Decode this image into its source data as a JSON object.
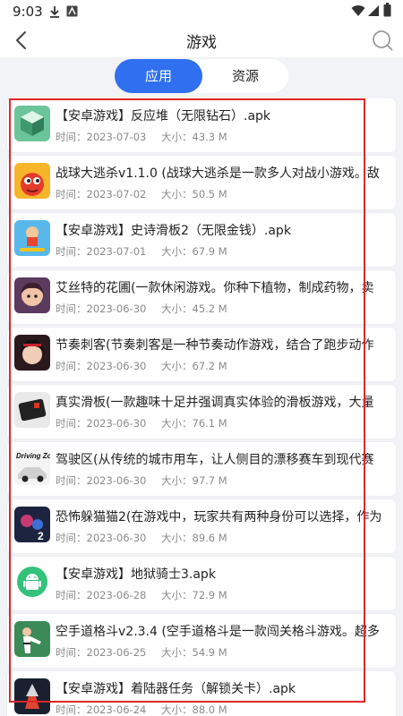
{
  "status": {
    "time": "9:03"
  },
  "header": {
    "title": "游戏"
  },
  "tabs": [
    {
      "label": "应用",
      "active": true
    },
    {
      "label": "资源",
      "active": false
    }
  ],
  "items": [
    {
      "name": "【安卓游戏】反应堆（无限钻石）.apk",
      "time": "时间：2023-07-03",
      "size": "大小：43.3 M",
      "icon": "cube-game-icon"
    },
    {
      "name": "战球大逃杀v1.1.0 (战球大逃杀是一款多人对战小游戏。敌",
      "time": "时间：2023-07-02",
      "size": "大小：50.5 M",
      "icon": "red-ball-character-icon"
    },
    {
      "name": "【安卓游戏】史诗滑板2（无限金钱）.apk",
      "time": "时间：2023-07-01",
      "size": "大小：67.9 M",
      "icon": "skateboard-game-icon"
    },
    {
      "name": "艾丝特的花圃(一款休闲游戏。你种下植物，制成药物，卖",
      "time": "时间：2023-06-30",
      "size": "大小：45.2 M",
      "icon": "girl-portrait-icon"
    },
    {
      "name": "节奏刺客(节奏刺客是一种节奏动作游戏，结合了跑步动作",
      "time": "时间：2023-06-30",
      "size": "大小：67.2 M",
      "icon": "assassin-girl-icon"
    },
    {
      "name": "真实滑板(一款趣味十足并强调真实体验的滑板游戏，大量",
      "time": "时间：2023-06-30",
      "size": "大小：76.1 M",
      "icon": "true-skate-icon"
    },
    {
      "name": "驾驶区(从传统的城市用车，让人侧目的漂移赛车到现代赛",
      "time": "时间：2023-06-30",
      "size": "大小：97.7 M",
      "icon": "driving-zone-icon",
      "icon_text": "Driving Zone"
    },
    {
      "name": "恐怖躲猫猫2(在游戏中，玩家共有两种身份可以选择，作为",
      "time": "时间：2023-06-30",
      "size": "大小：89.6 M",
      "icon": "horror-hide-seek-icon",
      "icon_text": "2"
    },
    {
      "name": "【安卓游戏】地狱骑士3.apk",
      "time": "时间：2023-06-28",
      "size": "大小：72.9 M",
      "icon": "android-icon"
    },
    {
      "name": "空手道格斗v2.3.4 (空手道格斗是一款闯关格斗游戏。超多",
      "time": "时间：2023-06-25",
      "size": "大小：54.9 M",
      "icon": "karate-fight-icon"
    },
    {
      "name": "【安卓游戏】着陆器任务（解锁关卡）.apk",
      "time": "时间：2023-06-24",
      "size": "大小：88.0 M",
      "icon": "lander-mission-icon"
    }
  ],
  "colors": {
    "accent": "#2f6ff0",
    "highlight_border": "#e0262a",
    "background": "#f2f3f6"
  }
}
